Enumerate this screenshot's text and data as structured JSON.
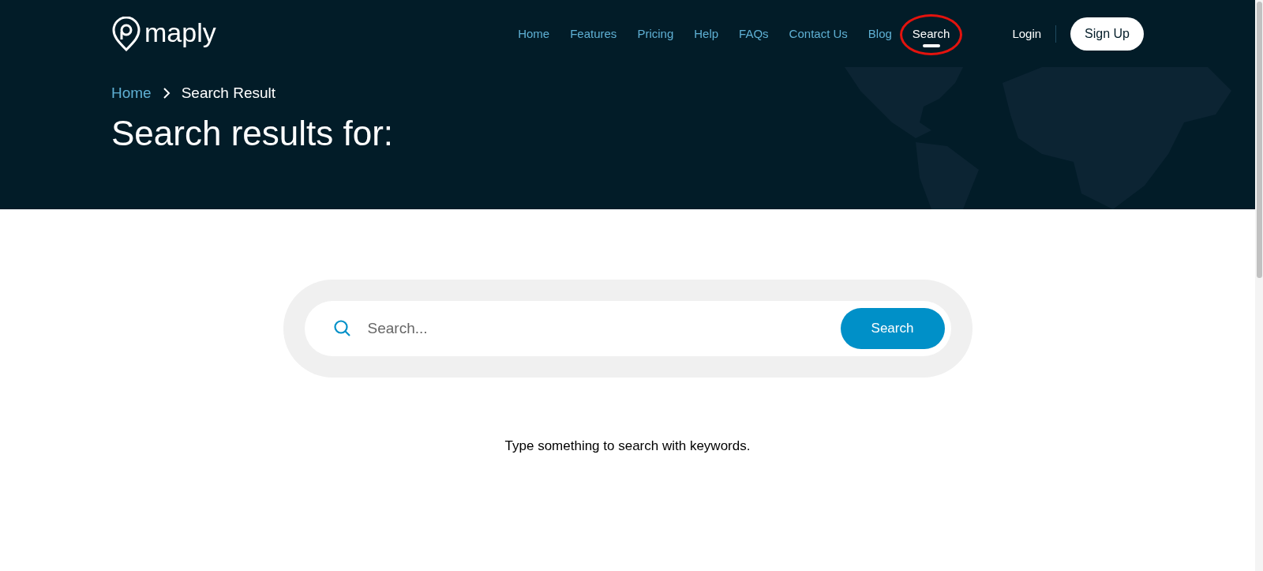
{
  "logo": {
    "text": "maply"
  },
  "nav": {
    "items": [
      {
        "label": "Home",
        "selected": false,
        "annotated": false
      },
      {
        "label": "Features",
        "selected": false,
        "annotated": false
      },
      {
        "label": "Pricing",
        "selected": false,
        "annotated": false
      },
      {
        "label": "Help",
        "selected": false,
        "annotated": false
      },
      {
        "label": "FAQs",
        "selected": false,
        "annotated": false
      },
      {
        "label": "Contact Us",
        "selected": false,
        "annotated": false
      },
      {
        "label": "Blog",
        "selected": false,
        "annotated": false
      },
      {
        "label": "Search",
        "selected": true,
        "annotated": true
      }
    ],
    "login": "Login",
    "signup": "Sign Up"
  },
  "breadcrumb": [
    {
      "label": "Home",
      "kind": "link"
    },
    {
      "label": "Search Result",
      "kind": "current"
    }
  ],
  "heading": "Search results for:",
  "search": {
    "placeholder": "Search...",
    "button": "Search"
  },
  "message": "Type something to search with keywords."
}
